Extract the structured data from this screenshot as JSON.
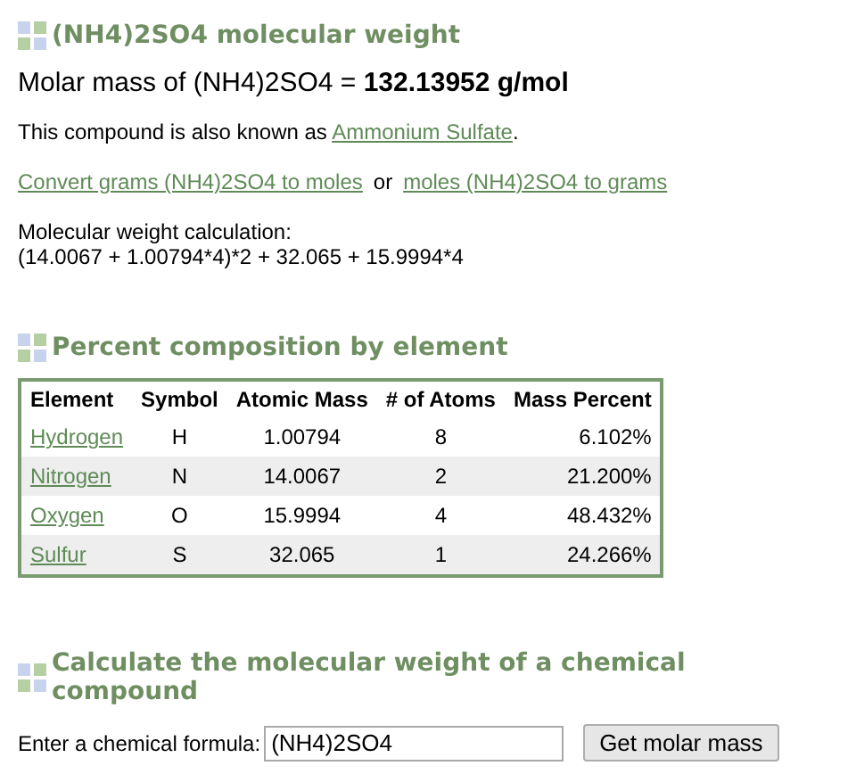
{
  "title": "(NH4)2SO4 molecular weight",
  "molar_mass": {
    "label": "Molar mass of (NH4)2SO4 = ",
    "value": "132.13952 g/mol"
  },
  "also_known": {
    "text": "This compound is also known as ",
    "link": "Ammonium Sulfate",
    "end": "."
  },
  "conversions": {
    "first": "Convert grams (NH4)2SO4 to moles",
    "separator": "or",
    "second": "moles (NH4)2SO4 to grams"
  },
  "calculation": {
    "label": "Molecular weight calculation:",
    "formula": "(14.0067 + 1.00794*4)*2 + 32.065 + 15.9994*4"
  },
  "composition": {
    "heading": "Percent composition by element",
    "columns": [
      "Element",
      "Symbol",
      "Atomic Mass",
      "# of Atoms",
      "Mass Percent"
    ],
    "rows": [
      {
        "element": "Hydrogen",
        "symbol": "H",
        "mass": "1.00794",
        "atoms": "8",
        "percent": "6.102%"
      },
      {
        "element": "Nitrogen",
        "symbol": "N",
        "mass": "14.0067",
        "atoms": "2",
        "percent": "21.200%"
      },
      {
        "element": "Oxygen",
        "symbol": "O",
        "mass": "15.9994",
        "atoms": "4",
        "percent": "48.432%"
      },
      {
        "element": "Sulfur",
        "symbol": "S",
        "mass": "32.065",
        "atoms": "1",
        "percent": "24.266%"
      }
    ]
  },
  "calculator": {
    "heading": "Calculate the molecular weight of a chemical compound",
    "label": "Enter a chemical formula:",
    "value": "(NH4)2SO4",
    "button": "Get molar mass"
  }
}
